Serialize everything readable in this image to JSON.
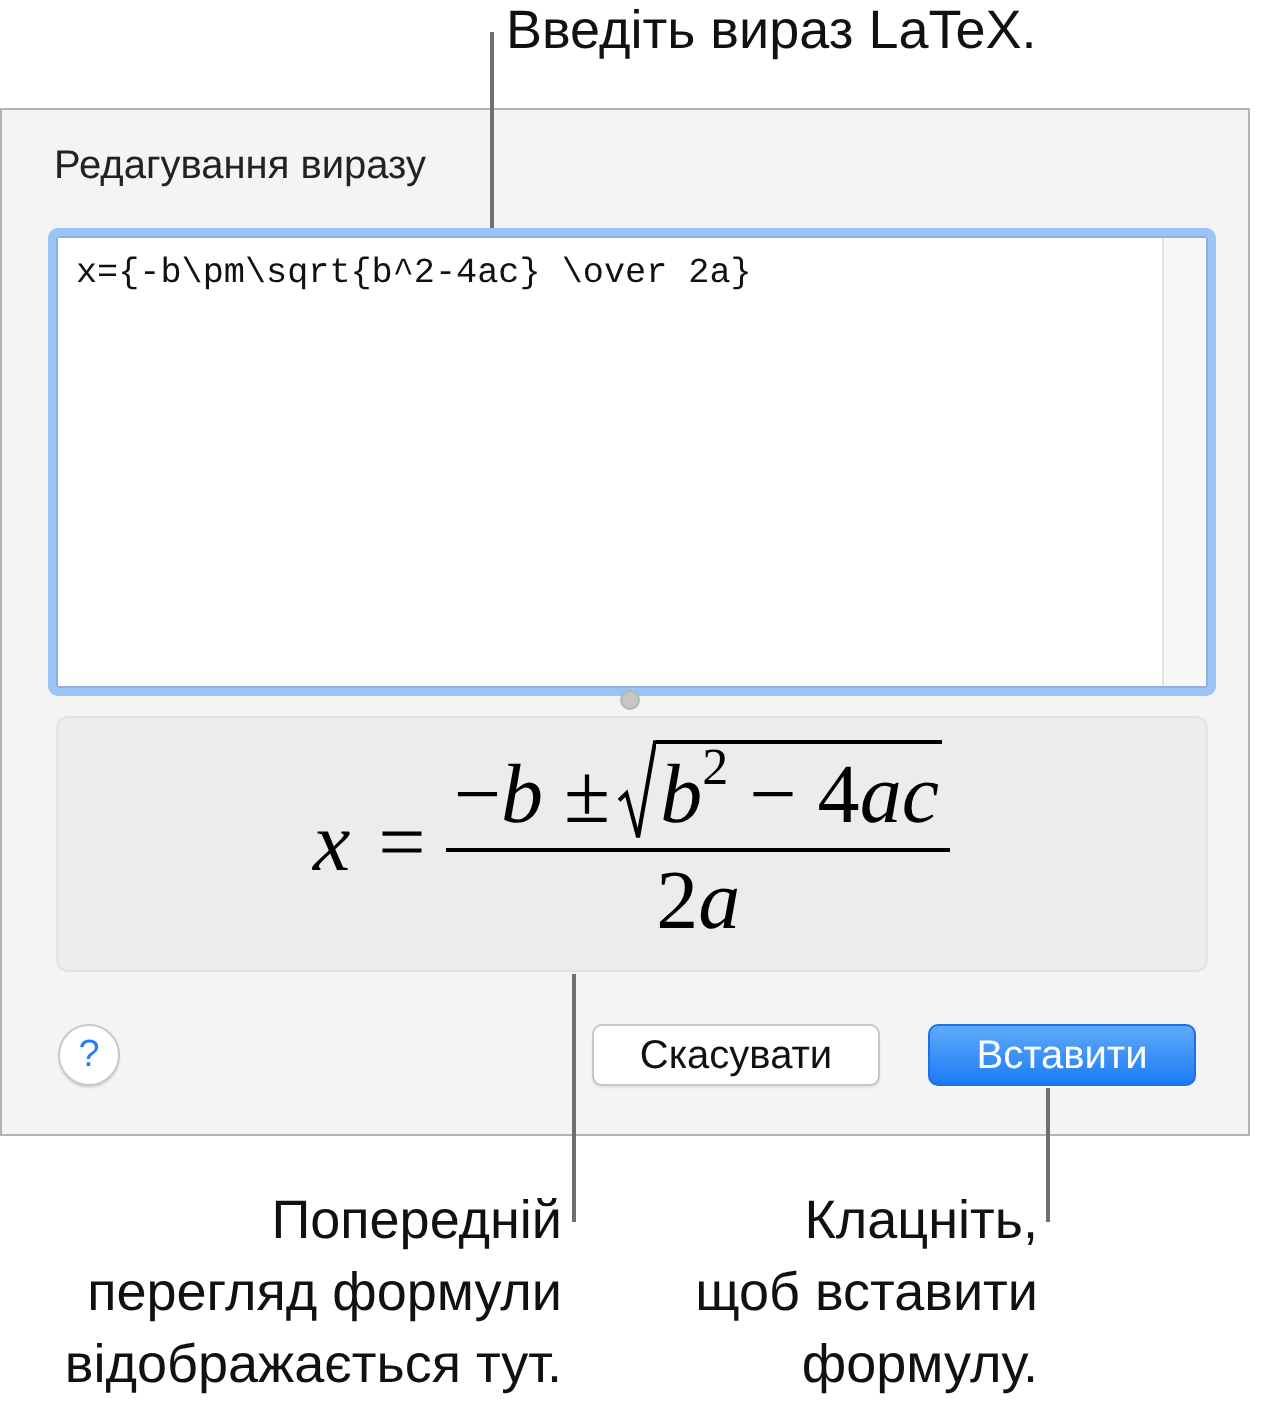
{
  "callout_top": {
    "text": "Введіть вираз LaTeX."
  },
  "dialog": {
    "title": "Редагування виразу",
    "latex_field": {
      "value": "x={-b\\pm\\sqrt{b^2-4ac} \\over 2a}",
      "focused": true
    },
    "preview": {
      "lhs": "x",
      "relation": "=",
      "numerator": "−b ±",
      "radicand": "b$^{2}$ − 4ac",
      "denominator": "2a"
    },
    "help_button": "?",
    "buttons": [
      {
        "label": "Скасувати",
        "kind": "secondary"
      },
      {
        "label": "Вставити",
        "kind": "default"
      }
    ]
  },
  "callouts_bottom": [
    {
      "text": "Попередній\nперегляд формули\nвідображається тут."
    },
    {
      "text": "Клацніть,\nщоб вставити\nформулу."
    }
  ]
}
